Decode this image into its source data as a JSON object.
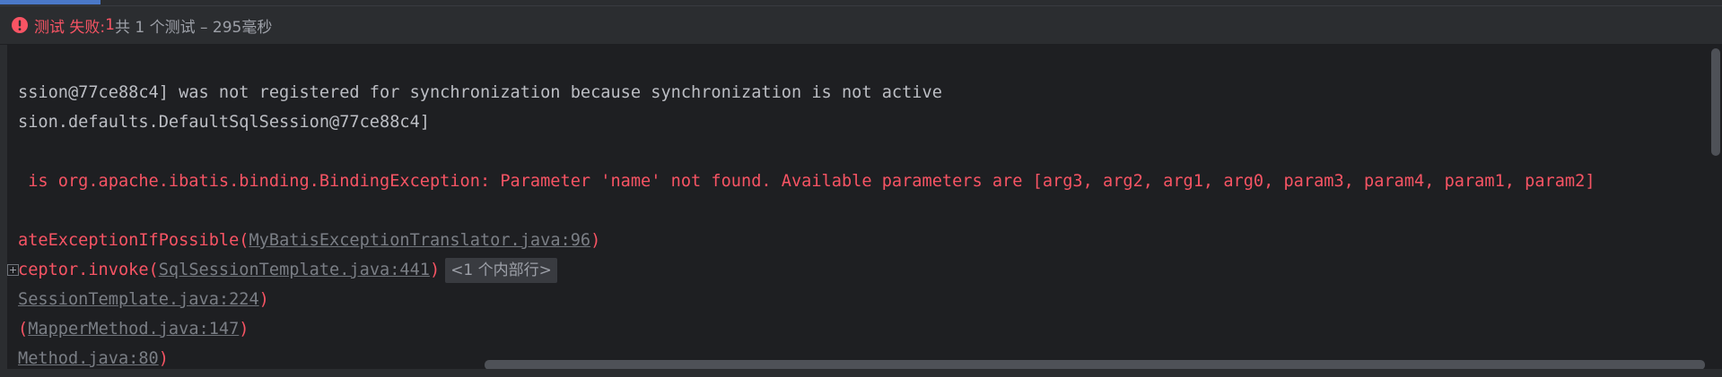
{
  "status": {
    "failed_label": "测试 失败:",
    "failed_count": "1",
    "detail": "共 1 个测试 – 295毫秒"
  },
  "console": {
    "lines": [
      {
        "segments": [
          {
            "text": "ssion@77ce88c4] was not registered for synchronization because synchronization is not active",
            "kind": "plain"
          }
        ]
      },
      {
        "segments": [
          {
            "text": "sion.defaults.DefaultSqlSession@77ce88c4]",
            "kind": "plain"
          }
        ]
      },
      {
        "segments": []
      },
      {
        "segments": [
          {
            "text": " is org.apache.ibatis.binding.BindingException: Parameter 'name' not found. Available parameters are [arg3, arg2, arg1, arg0, param3, param4, param1, param2]",
            "kind": "err"
          }
        ]
      },
      {
        "segments": []
      },
      {
        "segments": [
          {
            "text": "ateExceptionIfPossible(",
            "kind": "err"
          },
          {
            "text": "MyBatisExceptionTranslator.java:96",
            "kind": "link"
          },
          {
            "text": ")",
            "kind": "err"
          }
        ]
      },
      {
        "fold": true,
        "segments": [
          {
            "text": "ceptor.invoke(",
            "kind": "err"
          },
          {
            "text": "SqlSessionTemplate.java:441",
            "kind": "link"
          },
          {
            "text": ")",
            "kind": "err"
          }
        ],
        "badge": "<1 个内部行>"
      },
      {
        "segments": [
          {
            "text": "SessionTemplate.java:224",
            "kind": "link"
          },
          {
            "text": ")",
            "kind": "err"
          }
        ]
      },
      {
        "segments": [
          {
            "text": "(",
            "kind": "err"
          },
          {
            "text": "MapperMethod.java:147",
            "kind": "link"
          },
          {
            "text": ")",
            "kind": "err"
          }
        ]
      },
      {
        "segments": [
          {
            "text": "Method.java:80",
            "kind": "link"
          },
          {
            "text": ")",
            "kind": "err"
          }
        ]
      }
    ]
  },
  "icons": {
    "status": "error-circle-icon",
    "fold": "expand-fold-icon"
  },
  "colors": {
    "error": "#f75464",
    "plain": "#bcbec4",
    "link": "#7a7e85",
    "background": "#1e1f22",
    "header": "#2b2d30"
  }
}
